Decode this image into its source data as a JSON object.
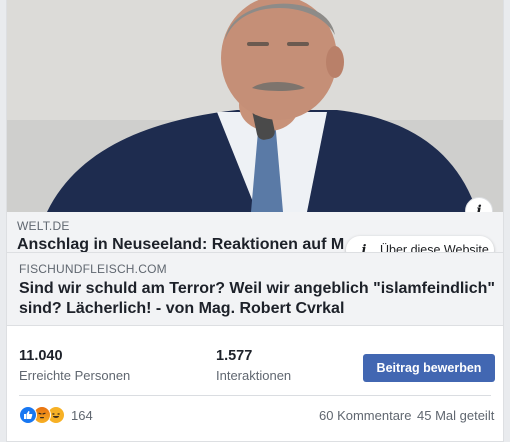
{
  "preview": {
    "domain": "WELT.DE",
    "title": "Anschlag in Neuseeland: Reaktionen auf M"
  },
  "tooltip": {
    "icon": "i",
    "label": "Über diese Website"
  },
  "photo": {
    "info_icon": "i"
  },
  "link": {
    "domain": "FISCHUNDFLEISCH.COM",
    "title": "Sind wir schuld am Terror? Weil wir angeblich \"islamfeindlich\" sind? Lächerlich! - von Mag. Robert Cvrkal"
  },
  "stats": {
    "reach_value": "11.040",
    "reach_label": "Erreichte Personen",
    "engagement_value": "1.577",
    "engagement_label": "Interaktionen",
    "boost_label": "Beitrag bewerben"
  },
  "footer": {
    "reactions": [
      "like",
      "angry",
      "haha"
    ],
    "reaction_count": "164",
    "comments": "60 Kommentare",
    "shares": "45 Mal geteilt"
  },
  "colors": {
    "boost_button": "#4267b2",
    "like": "#1877f2",
    "haha": "#f7b125"
  }
}
